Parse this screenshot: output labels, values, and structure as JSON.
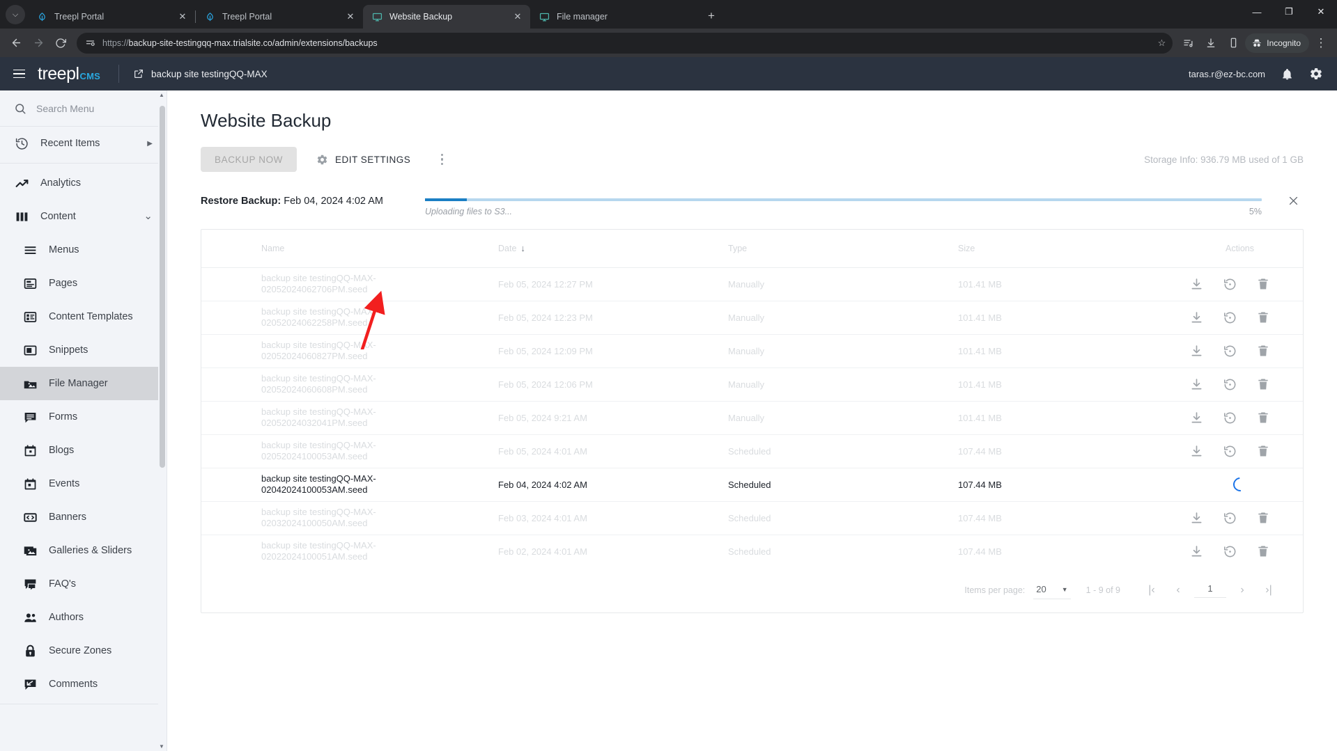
{
  "browser": {
    "tabs": [
      {
        "title": "Treepl Portal",
        "icon": "treepl-icon",
        "active": false,
        "closable": true
      },
      {
        "title": "Treepl Portal",
        "icon": "treepl-icon",
        "active": false,
        "closable": true
      },
      {
        "title": "Website Backup",
        "icon": "monitor-icon",
        "active": true,
        "closable": true
      },
      {
        "title": "File manager",
        "icon": "monitor-icon",
        "active": false,
        "closable": false
      }
    ],
    "tab_close_label": "✕",
    "new_tab_label": "+",
    "tab_search_label": "⌵",
    "window_controls": {
      "minimize": "—",
      "maximize": "❐",
      "close": "✕"
    },
    "nav": {
      "back": "←",
      "forward": "→",
      "reload": "⟳"
    },
    "url": "https://backup-site-testingqq-max.trialsite.co/admin/extensions/backups",
    "url_scheme": "https://",
    "url_rest": "backup-site-testingqq-max.trialsite.co/admin/extensions/backups",
    "star_label": "☆",
    "incognito_label": "Incognito",
    "menu_label": "⋮"
  },
  "cms_header": {
    "logo_text": "treepl",
    "logo_suffix": "CMS",
    "site_name": "backup site testingQQ-MAX",
    "user_email": "taras.r@ez-bc.com"
  },
  "sidebar": {
    "search_placeholder": "Search Menu",
    "recent_items": {
      "label": "Recent Items",
      "chevron": "▶"
    },
    "items": [
      {
        "label": "Analytics",
        "icon": "analytics-icon",
        "level": 0,
        "active": false
      },
      {
        "label": "Content",
        "icon": "content-icon",
        "level": 0,
        "active": false,
        "expanded": true,
        "chevron": "⌄"
      },
      {
        "label": "Menus",
        "icon": "menus-icon",
        "level": 1,
        "active": false
      },
      {
        "label": "Pages",
        "icon": "pages-icon",
        "level": 1,
        "active": false
      },
      {
        "label": "Content Templates",
        "icon": "content-templates-icon",
        "level": 1,
        "active": false
      },
      {
        "label": "Snippets",
        "icon": "snippets-icon",
        "level": 1,
        "active": false
      },
      {
        "label": "File Manager",
        "icon": "file-manager-icon",
        "level": 1,
        "active": true
      },
      {
        "label": "Forms",
        "icon": "forms-icon",
        "level": 1,
        "active": false
      },
      {
        "label": "Blogs",
        "icon": "blogs-icon",
        "level": 1,
        "active": false
      },
      {
        "label": "Events",
        "icon": "events-icon",
        "level": 1,
        "active": false
      },
      {
        "label": "Banners",
        "icon": "banners-icon",
        "level": 1,
        "active": false
      },
      {
        "label": "Galleries & Sliders",
        "icon": "galleries-icon",
        "level": 1,
        "active": false
      },
      {
        "label": "FAQ's",
        "icon": "faq-icon",
        "level": 1,
        "active": false
      },
      {
        "label": "Authors",
        "icon": "authors-icon",
        "level": 1,
        "active": false
      },
      {
        "label": "Secure Zones",
        "icon": "secure-zones-icon",
        "level": 1,
        "active": false
      },
      {
        "label": "Comments",
        "icon": "comments-icon",
        "level": 1,
        "active": false
      }
    ]
  },
  "main": {
    "page_title": "Website Backup",
    "backup_now_label": "BACKUP NOW",
    "edit_settings_label": "EDIT SETTINGS",
    "storage_info": "Storage Info: 936.79 MB used of 1 GB",
    "restore": {
      "label": "Restore Backup:",
      "value": "Feb 04, 2024 4:02 AM"
    },
    "progress": {
      "status": "Uploading files to S3...",
      "percent_label": "5%",
      "percent": 5,
      "fill_color": "#1b7fc4",
      "track_color": "#b6d7ee",
      "close_label": "✕"
    },
    "table": {
      "columns": [
        "Name",
        "Date",
        "Type",
        "Size",
        "Actions"
      ],
      "sort_column": "Date",
      "sort_arrow": "↓",
      "rows": [
        {
          "name": "backup site testingQQ-MAX-02052024062706PM.seed",
          "date": "Feb 05, 2024 12:27 PM",
          "type": "Manually",
          "size": "101.41 MB",
          "state": "idle"
        },
        {
          "name": "backup site testingQQ-MAX-02052024062258PM.seed",
          "date": "Feb 05, 2024 12:23 PM",
          "type": "Manually",
          "size": "101.41 MB",
          "state": "idle"
        },
        {
          "name": "backup site testingQQ-MAX-02052024060827PM.seed",
          "date": "Feb 05, 2024 12:09 PM",
          "type": "Manually",
          "size": "101.41 MB",
          "state": "idle"
        },
        {
          "name": "backup site testingQQ-MAX-02052024060608PM.seed",
          "date": "Feb 05, 2024 12:06 PM",
          "type": "Manually",
          "size": "101.41 MB",
          "state": "idle"
        },
        {
          "name": "backup site testingQQ-MAX-02052024032041PM.seed",
          "date": "Feb 05, 2024 9:21 AM",
          "type": "Manually",
          "size": "101.41 MB",
          "state": "idle"
        },
        {
          "name": "backup site testingQQ-MAX-02052024100053AM.seed",
          "date": "Feb 05, 2024 4:01 AM",
          "type": "Scheduled",
          "size": "107.44 MB",
          "state": "idle"
        },
        {
          "name": "backup site testingQQ-MAX-02042024100053AM.seed",
          "date": "Feb 04, 2024 4:02 AM",
          "type": "Scheduled",
          "size": "107.44 MB",
          "state": "loading"
        },
        {
          "name": "backup site testingQQ-MAX-02032024100050AM.seed",
          "date": "Feb 03, 2024 4:01 AM",
          "type": "Scheduled",
          "size": "107.44 MB",
          "state": "idle"
        },
        {
          "name": "backup site testingQQ-MAX-02022024100051AM.seed",
          "date": "Feb 02, 2024 4:01 AM",
          "type": "Scheduled",
          "size": "107.44 MB",
          "state": "idle"
        }
      ],
      "row_actions": [
        "download-icon",
        "restore-icon",
        "delete-icon"
      ]
    },
    "pager": {
      "items_per_page_label": "Items per page:",
      "items_per_page_value": "20",
      "caret": "▼",
      "range_label": "1 - 9 of 9",
      "first_label": "|‹",
      "prev_label": "‹",
      "page_value": "1",
      "next_label": "›",
      "last_label": "›|"
    }
  },
  "annotation": {
    "type": "red-arrow",
    "color": "#f21f1f"
  }
}
